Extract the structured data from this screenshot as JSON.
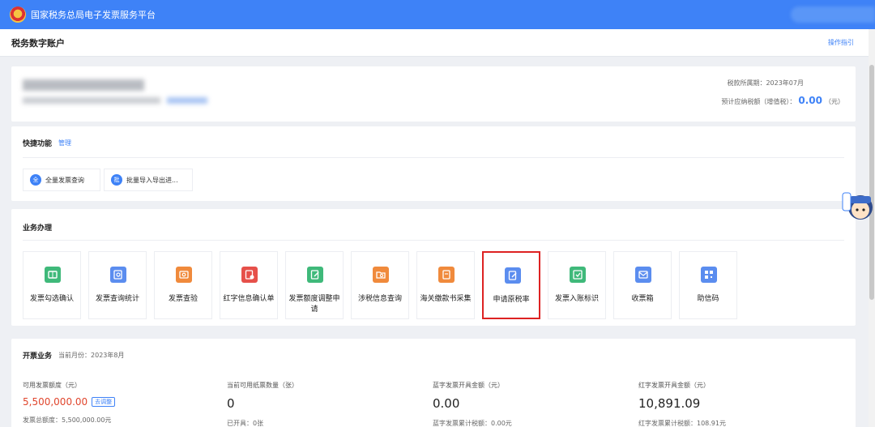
{
  "topbar": {
    "title": "国家税务总局电子发票服务平台"
  },
  "titlebar": {
    "page_title": "税务数字账户",
    "guide_link": "操作指引"
  },
  "company": {
    "period_line": "税款所属期：2023年07月",
    "tax_label": "预计应纳税额（增值税）：",
    "tax_amount": "0.00",
    "tax_unit": "（元）"
  },
  "quick": {
    "title": "快捷功能",
    "manage": "管理",
    "items": [
      {
        "icon_text": "全",
        "label": "全量发票查询"
      },
      {
        "icon_text": "批",
        "label": "批量导入导出进..."
      }
    ]
  },
  "biz": {
    "title": "业务办理",
    "tiles": [
      {
        "label": "发票勾选确认",
        "icon": "ticket-icon",
        "color": "#3fb97a"
      },
      {
        "label": "发票查询统计",
        "icon": "search-doc-icon",
        "color": "#5b8def"
      },
      {
        "label": "发票查验",
        "icon": "scan-icon",
        "color": "#f08a3c"
      },
      {
        "label": "红字信息确认单",
        "icon": "doc-check-icon",
        "color": "#e6504a"
      },
      {
        "label": "发票额度调整申请",
        "icon": "edit-doc-icon",
        "color": "#3fb97a"
      },
      {
        "label": "涉税信息查询",
        "icon": "folder-search-icon",
        "color": "#f08a3c"
      },
      {
        "label": "海关缴款书采集",
        "icon": "collect-doc-icon",
        "color": "#f08a3c"
      },
      {
        "label": "申请原税率",
        "icon": "apply-doc-icon",
        "color": "#5b8def"
      },
      {
        "label": "发票入账标识",
        "icon": "stamp-icon",
        "color": "#3fb97a"
      },
      {
        "label": "收票箱",
        "icon": "mail-icon",
        "color": "#5b8def"
      },
      {
        "label": "助信码",
        "icon": "qrcode-icon",
        "color": "#5b8def"
      }
    ]
  },
  "invoice": {
    "title": "开票业务",
    "month": "当前月份：2023年8月",
    "stats": [
      {
        "label": "可用发票额度（元）",
        "value": "5,500,000.00",
        "tag": "去调整",
        "sub": "发票总额度：5,500,000.00元"
      },
      {
        "label": "当前可用纸票数量（张）",
        "value": "0",
        "sub": "已开具：0张"
      },
      {
        "label": "蓝字发票开具金额（元）",
        "value": "0.00",
        "sub": "蓝字发票累计税额：0.00元"
      },
      {
        "label": "红字发票开具金额（元）",
        "value": "10,891.09",
        "sub": "红字发票累计税额：108.91元"
      }
    ]
  },
  "colors": {
    "brand": "#3e82f7",
    "highlight": "#d22",
    "amount_red": "#e0452c"
  }
}
